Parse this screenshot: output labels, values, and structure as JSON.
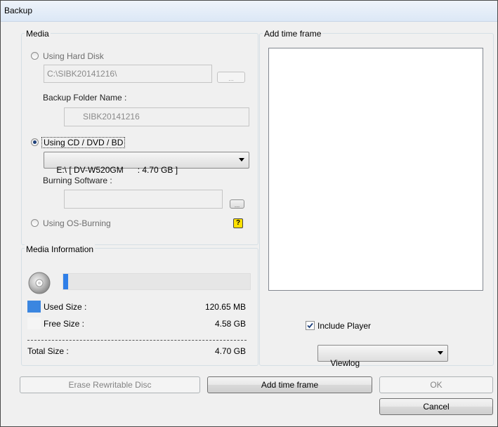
{
  "window": {
    "title": "Backup"
  },
  "media": {
    "legend": "Media",
    "hard_disk": {
      "label": "Using Hard Disk",
      "path_value": "C:\\SIBK20141216\\",
      "browse_label": "...",
      "folder_name_label": "Backup Folder Name :",
      "folder_name_value": "SIBK20141216"
    },
    "cd_dvd_bd": {
      "label": "Using CD / DVD / BD",
      "drive_value": "E:\\ [ DV-W520GM      : 4.70 GB ]",
      "burning_software_label": "Burning Software :",
      "burning_software_value": "",
      "browse_label": "..."
    },
    "os_burning": {
      "label": "Using OS-Burning",
      "help_glyph": "?"
    },
    "selected": "cd_dvd_bd"
  },
  "media_information": {
    "legend": "Media Information",
    "usage_fraction": 0.026,
    "used_label": "Used Size :",
    "used_value": "120.65 MB",
    "free_label": "Free Size :",
    "free_value": "4.58 GB",
    "total_label": "Total Size :",
    "total_value": "4.70 GB",
    "colors": {
      "used": "#3b86e0",
      "free": "#f5f5f5",
      "progress_fill": "#2f7fe8"
    }
  },
  "time_frame": {
    "legend": "Add time frame",
    "items": [],
    "include_player_label": "Include Player",
    "include_player_checked": true,
    "player_value": "Viewlog"
  },
  "buttons": {
    "erase_label": "Erase Rewritable Disc",
    "add_time_frame_label": "Add time frame",
    "ok_label": "OK",
    "cancel_label": "Cancel"
  },
  "icons": {
    "disc": "cd-disc-icon",
    "help": "help-question-icon",
    "dropdown": "chevron-down-icon"
  }
}
